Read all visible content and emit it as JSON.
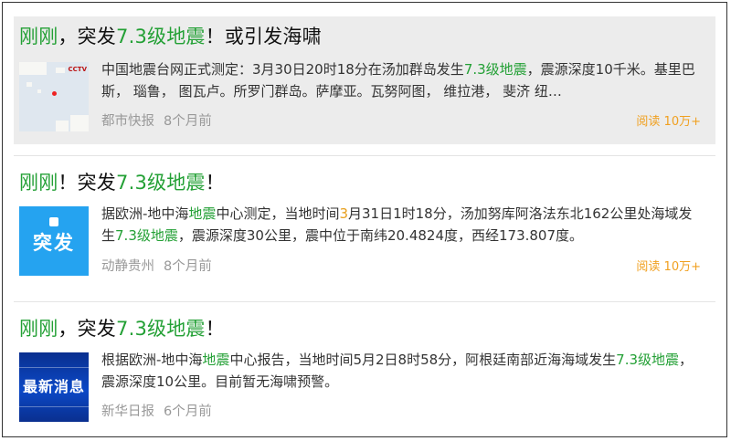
{
  "results": [
    {
      "title_parts": [
        {
          "text": "刚刚",
          "hl": true
        },
        {
          "text": "，突发",
          "hl": false
        },
        {
          "text": "7.3级地震",
          "hl": true
        },
        {
          "text": "！或引发海啸",
          "hl": false
        }
      ],
      "thumbnail": {
        "type": "map",
        "tag": "CCTV"
      },
      "summary_parts": [
        {
          "text": "中国地震台网正式测定：3月30日20时18分在汤加群岛发生",
          "hl": ""
        },
        {
          "text": "7.3级地震",
          "hl": "g"
        },
        {
          "text": "，震源深度10千米。基里巴斯， 瑙鲁， 图瓦卢。所罗门群岛。萨摩亚。瓦努阿图， 维拉港， 斐济 纽…",
          "hl": ""
        }
      ],
      "source": "都市快报",
      "time": "8个月前",
      "reads": "阅读 10万+"
    },
    {
      "title_parts": [
        {
          "text": "刚刚",
          "hl": true
        },
        {
          "text": "！突发",
          "hl": false
        },
        {
          "text": "7.3级地震",
          "hl": true
        },
        {
          "text": "！",
          "hl": false
        }
      ],
      "thumbnail": {
        "type": "blue",
        "text": "突发"
      },
      "summary_parts": [
        {
          "text": "据欧洲-地中海",
          "hl": ""
        },
        {
          "text": "地震",
          "hl": "g"
        },
        {
          "text": "中心测定，当地时间",
          "hl": ""
        },
        {
          "text": "3",
          "hl": "o"
        },
        {
          "text": "月31日1时18分，汤加努库阿洛法东北162公里处海域发生",
          "hl": ""
        },
        {
          "text": "7.3级地震",
          "hl": "g"
        },
        {
          "text": "，震源深度30公里，震中位于南纬20.4824度，西经173.807度。",
          "hl": ""
        }
      ],
      "source": "动静贵州",
      "time": "8个月前",
      "reads": "阅读 10万+"
    },
    {
      "title_parts": [
        {
          "text": "刚刚",
          "hl": true
        },
        {
          "text": "，突发",
          "hl": false
        },
        {
          "text": "7.3级地震",
          "hl": true
        },
        {
          "text": "！",
          "hl": false
        }
      ],
      "thumbnail": {
        "type": "news",
        "text": "最新消息"
      },
      "summary_parts": [
        {
          "text": "根据欧洲-地中海",
          "hl": ""
        },
        {
          "text": "地震",
          "hl": "g"
        },
        {
          "text": "中心报告，当地时间5月2日8时58分，阿根廷南部近海海域发生",
          "hl": ""
        },
        {
          "text": "7.3级地震",
          "hl": "g"
        },
        {
          "text": "，震源深度10公里。目前暂无海啸预警。",
          "hl": ""
        }
      ],
      "source": "新华日报",
      "time": "6个月前",
      "reads": ""
    }
  ]
}
